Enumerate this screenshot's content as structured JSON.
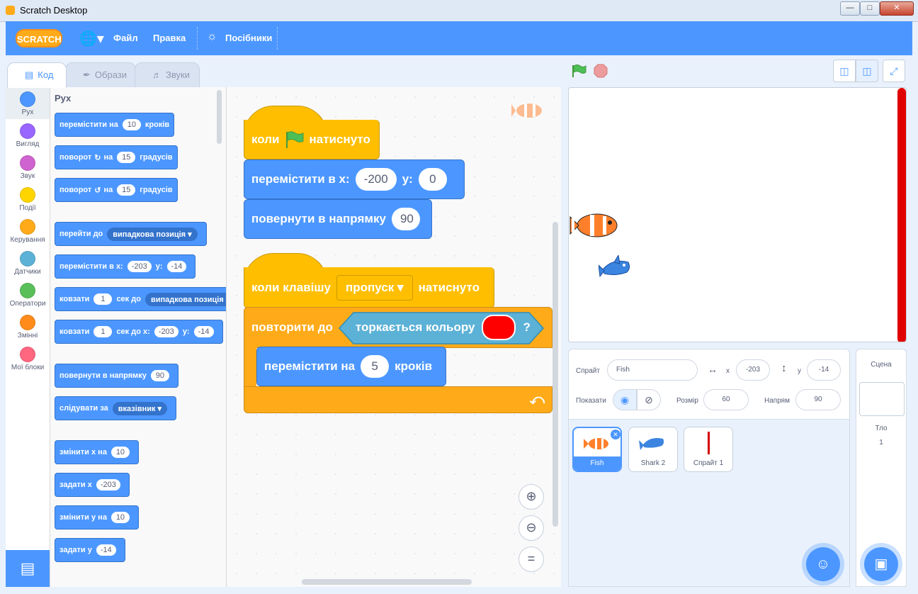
{
  "window": {
    "title": "Scratch Desktop",
    "min": "0",
    "max": "1",
    "close": "r"
  },
  "menu": {
    "logo": "SCRATCH",
    "file": "Файл",
    "edit": "Правка",
    "tutorials": "Посібники"
  },
  "tabs": {
    "code": "Код",
    "costumes": "Образи",
    "sounds": "Звуки"
  },
  "categories": [
    {
      "label": "Рух",
      "color": "#4c97ff"
    },
    {
      "label": "Вигляд",
      "color": "#9966ff"
    },
    {
      "label": "Звук",
      "color": "#cf63cf"
    },
    {
      "label": "Події",
      "color": "#ffd500"
    },
    {
      "label": "Керування",
      "color": "#ffab19"
    },
    {
      "label": "Датчики",
      "color": "#5cb1d6"
    },
    {
      "label": "Оператори",
      "color": "#59c059"
    },
    {
      "label": "Змінні",
      "color": "#ff8c1a"
    },
    {
      "label": "Мої блоки",
      "color": "#ff6680"
    }
  ],
  "palette": {
    "heading": "Рух",
    "b1": {
      "a": "перемістити на",
      "v": "10",
      "b": "кроків"
    },
    "b2": {
      "a": "поворот",
      "b": "на",
      "v": "15",
      "c": "градусів"
    },
    "b3": {
      "a": "поворот",
      "b": "на",
      "v": "15",
      "c": "градусів"
    },
    "b4": {
      "a": "перейти до",
      "d": "випадкова позиція"
    },
    "b5": {
      "a": "перемістити в x:",
      "v1": "-203",
      "b": "y:",
      "v2": "-14"
    },
    "b6": {
      "a": "ковзати",
      "v": "1",
      "b": "сек до",
      "d": "випадкова позиція"
    },
    "b7": {
      "a": "ковзати",
      "v1": "1",
      "b": "сек до x:",
      "v2": "-203",
      "c": "y:",
      "v3": "-14"
    },
    "b8": {
      "a": "повернути в напрямку",
      "v": "90"
    },
    "b9": {
      "a": "слідувати за",
      "d": "вказівник"
    },
    "b10": {
      "a": "змінити x на",
      "v": "10"
    },
    "b11": {
      "a": "задати x",
      "v": "-203"
    },
    "b12": {
      "a": "змінити y на",
      "v": "10"
    },
    "b13": {
      "a": "задати y",
      "v": "-14"
    }
  },
  "script1": {
    "hat": {
      "a": "коли",
      "b": "натиснуто"
    },
    "goto": {
      "a": "перемістити в x:",
      "x": "-200",
      "b": "y:",
      "y": "0"
    },
    "point": {
      "a": "повернути в напрямку",
      "v": "90"
    }
  },
  "script2": {
    "hat": {
      "a": "коли клавішу",
      "key": "пропуск",
      "b": "натиснуто"
    },
    "repeat": {
      "a": "повторити до",
      "cond": "торкається кольору",
      "q": "?",
      "color": "#ff0000"
    },
    "move": {
      "a": "перемістити на",
      "v": "5",
      "b": "кроків"
    }
  },
  "sprite": {
    "label": "Спрайт",
    "name": "Fish",
    "x_label": "x",
    "x": "-203",
    "y_label": "y",
    "y": "-14",
    "show_label": "Показати",
    "size_label": "Розмір",
    "size": "60",
    "dir_label": "Напрям",
    "dir": "90"
  },
  "sprites": [
    "Fish",
    "Shark 2",
    "Спрайт 1"
  ],
  "stagepanel": {
    "title": "Сцена",
    "backdrop_label": "Тло",
    "backdrop_count": "1"
  }
}
